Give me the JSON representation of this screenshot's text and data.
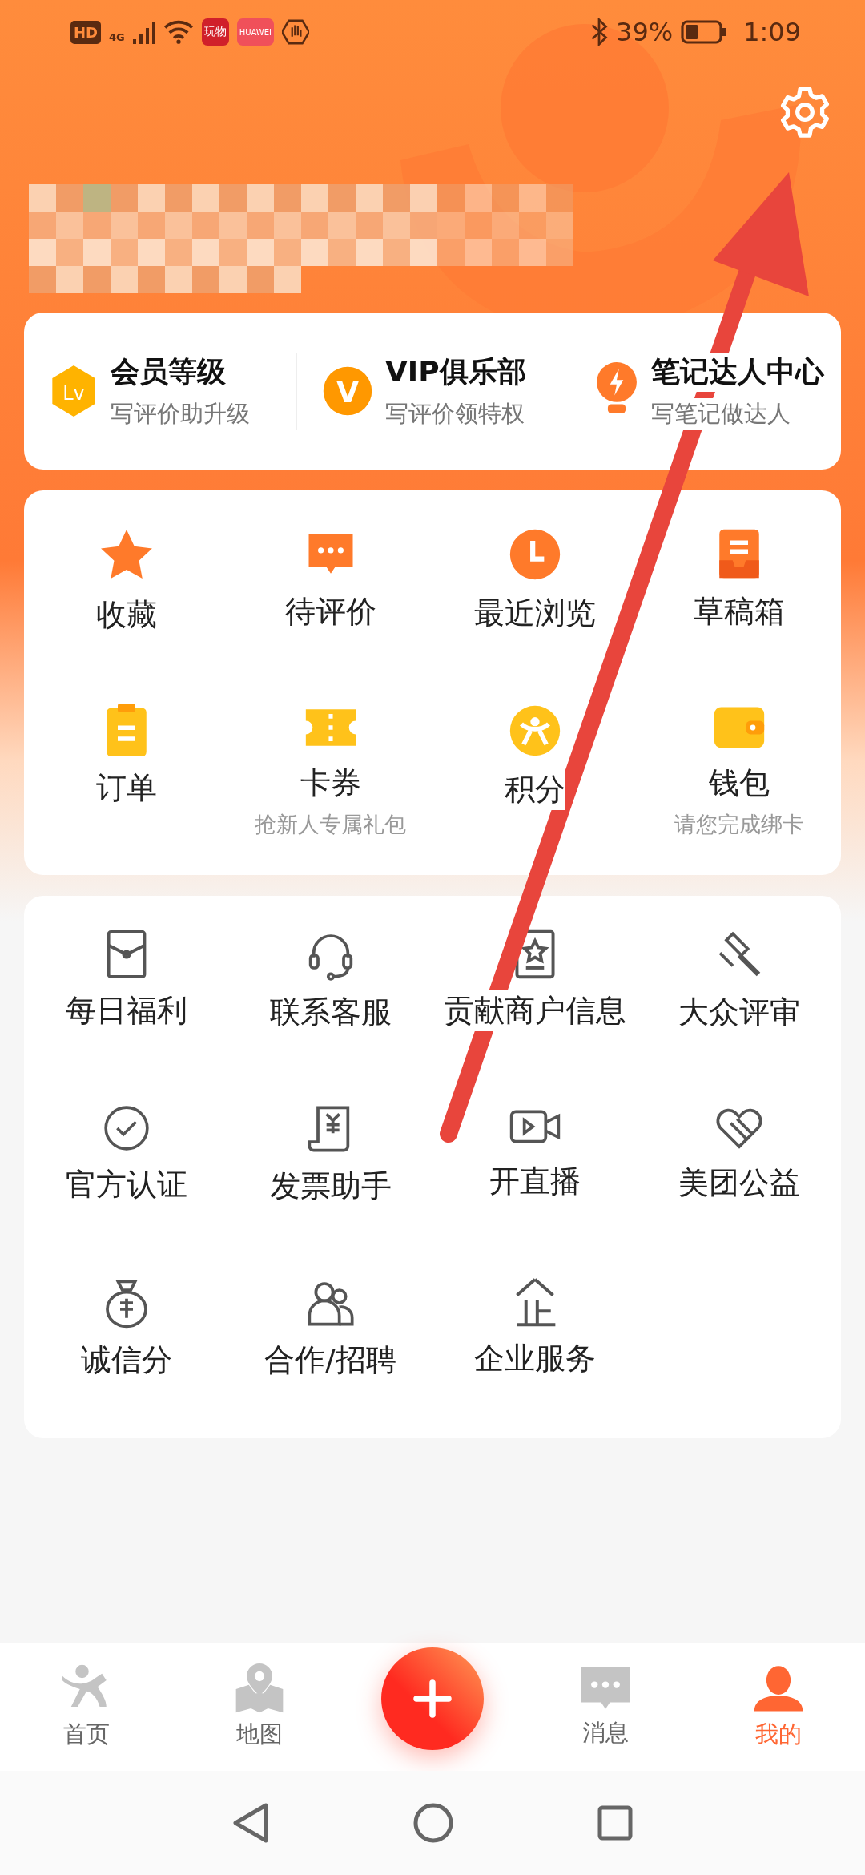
{
  "status_bar": {
    "network": "HD",
    "cell": "4G",
    "app_badges": [
      "玩物",
      "HUAWEI"
    ],
    "battery": "39%",
    "time": "1:09"
  },
  "quick_links": [
    {
      "title": "会员等级",
      "subtitle": "写评价助升级",
      "badge": "Lv"
    },
    {
      "title": "VIP俱乐部",
      "subtitle": "写评价领特权",
      "badge": "V"
    },
    {
      "title": "笔记达人中心",
      "subtitle": "写笔记做达人"
    }
  ],
  "features": [
    {
      "label": "收藏"
    },
    {
      "label": "待评价"
    },
    {
      "label": "最近浏览"
    },
    {
      "label": "草稿箱"
    },
    {
      "label": "订单"
    },
    {
      "label": "卡券",
      "hint": "抢新人专属礼包"
    },
    {
      "label": "积分"
    },
    {
      "label": "钱包",
      "hint": "请您完成绑卡"
    }
  ],
  "services": [
    {
      "label": "每日福利"
    },
    {
      "label": "联系客服"
    },
    {
      "label": "贡献商户信息"
    },
    {
      "label": "大众评审"
    },
    {
      "label": "官方认证"
    },
    {
      "label": "发票助手"
    },
    {
      "label": "开直播"
    },
    {
      "label": "美团公益"
    },
    {
      "label": "诚信分"
    },
    {
      "label": "合作/招聘"
    },
    {
      "label": "企业服务"
    }
  ],
  "tab_bar": [
    {
      "label": "首页",
      "selected": false
    },
    {
      "label": "地图",
      "selected": false
    },
    {
      "kind": "add"
    },
    {
      "label": "消息",
      "selected": false
    },
    {
      "label": "我的",
      "selected": true
    }
  ]
}
